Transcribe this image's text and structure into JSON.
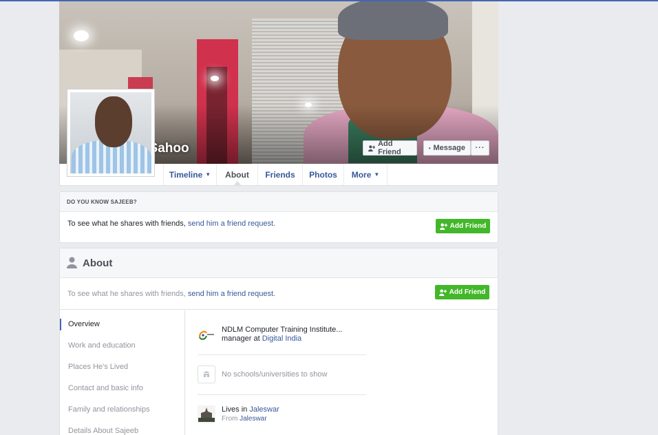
{
  "profile": {
    "name": "Sajeeb Sahoo"
  },
  "cover_buttons": {
    "add_friend": "Add Friend",
    "message": "Message",
    "more": "···"
  },
  "tabs": [
    {
      "label": "Timeline",
      "caret": true
    },
    {
      "label": "About",
      "caret": false
    },
    {
      "label": "Friends",
      "caret": false
    },
    {
      "label": "Photos",
      "caret": false
    },
    {
      "label": "More",
      "caret": true
    }
  ],
  "know_box": {
    "heading": "DO YOU KNOW SAJEEB?",
    "text": "To see what he shares with friends, ",
    "link": "send him a friend request.",
    "button": "Add Friend"
  },
  "about": {
    "title": "About",
    "text": "To see what he shares with friends, ",
    "link": "send him a friend request.",
    "button": "Add Friend",
    "sidebar": [
      "Overview",
      "Work and education",
      "Places He's Lived",
      "Contact and basic info",
      "Family and relationships",
      "Details About Sajeeb"
    ],
    "work": {
      "line1": "NDLM Computer Training Institute...",
      "line2_prefix": "manager at ",
      "line2_link": "Digital India"
    },
    "school": {
      "text": "No schools/universities to show"
    },
    "lives": {
      "prefix": "Lives in ",
      "place": "Jaleswar",
      "from_prefix": "From ",
      "from_place": "Jaleswar"
    }
  },
  "colors": {
    "link": "#365899",
    "green": "#42b72a",
    "topbar": "#4267b2"
  }
}
